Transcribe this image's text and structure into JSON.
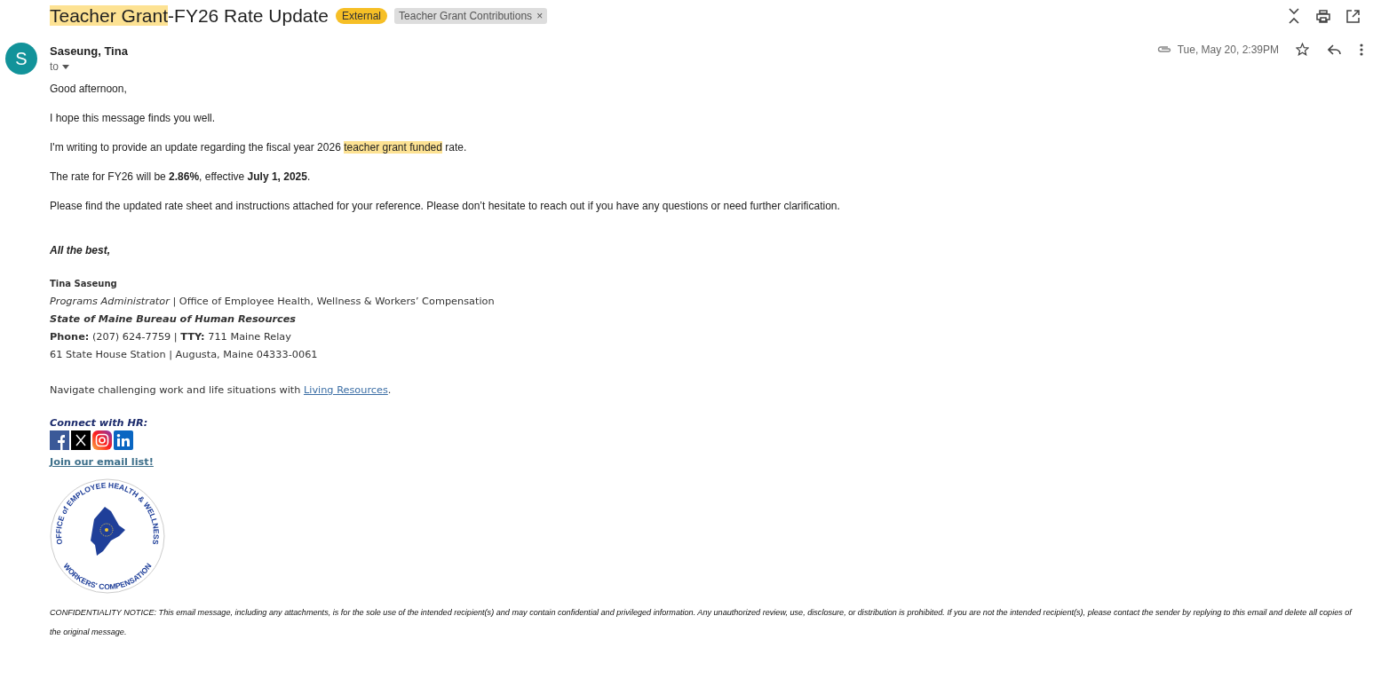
{
  "subject": {
    "segments": [
      {
        "text": "Teacher Grant",
        "highlighted": true
      },
      {
        "text": "-FY26 Rate Update",
        "highlighted": false
      }
    ]
  },
  "labels": [
    {
      "text": "External",
      "kind": "badge"
    },
    {
      "text": "Teacher Grant Contributions",
      "kind": "chip",
      "close": "×"
    }
  ],
  "sender": {
    "avatar": "S",
    "name": "Saseung, Tina",
    "to": "to",
    "date": "Tue, May 20, 2:39PM",
    "has_attachment": true,
    "starred": false
  },
  "body": [
    [
      {
        "text": "Good afternoon,",
        "highlighted": false
      }
    ],
    [
      {
        "text": "I hope this message finds you well.",
        "highlighted": false
      }
    ],
    [
      {
        "text": "I'm writing to provide an update regarding the fiscal year 2026 ",
        "highlighted": false
      },
      {
        "text": "teacher grant funded",
        "highlighted": true
      },
      {
        "text": " rate.",
        "highlighted": false
      }
    ],
    [
      {
        "text": "The rate for FY26 will be **2.86%**, effective **July 1, 2025**.",
        "highlighted": false
      }
    ],
    [
      {
        "text": "Please find the updated rate sheet and instructions attached for your reference. Please don’t hesitate to reach out if you have any questions or need further clarification.",
        "highlighted": false
      }
    ]
  ],
  "closing": "All the best,",
  "signature": {
    "name": "Tina Saseung",
    "title_line": "*Programs Administrator* | Office of Employee Health, Wellness & Workers’ Compensation",
    "org": "State of Maine Bureau of Human Resources",
    "phone_line": "**Phone:** (207) 624-7759 | **TTY:** 711 Maine Relay",
    "address": "61 State House Station | Augusta, Maine 04333-0061"
  },
  "resources": {
    "before": "Navigate challenging work and life situations with ",
    "link": "Living Resources",
    "after": "."
  },
  "connect": {
    "heading": "Connect with HR:",
    "socials": [
      {
        "kind": "facebook"
      },
      {
        "kind": "x"
      },
      {
        "kind": "instagram"
      },
      {
        "kind": "linkedin"
      }
    ],
    "email_list": "Join our email list!"
  },
  "logo": {
    "top_text": "OFFICE of EMPLOYEE HEALTH & WELLNESS",
    "bottom_text": "WORKERS' COMPENSATION"
  },
  "notice": "CONFIDENTIALITY NOTICE: This email message, including any attachments, is for the sole use of the intended recipient(s) and may contain confidential and privileged information. Any unauthorized review, use, disclosure, or distribution is prohibited. If you are not the intended recipient(s), please contact the sender by replying to this email and delete all copies of the original message."
}
